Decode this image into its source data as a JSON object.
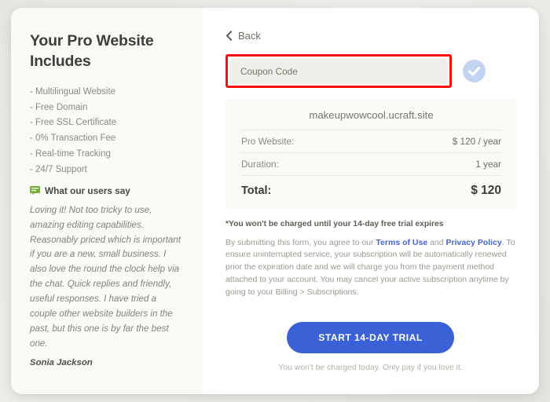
{
  "left_panel": {
    "title": "Your Pro Website Includes",
    "features": [
      "- Multilingual Website",
      "- Free Domain",
      "- Free SSL Certificate",
      "- 0% Transaction Fee",
      "- Real-time Tracking",
      "- 24/7 Support"
    ],
    "users_say_icon": "chat-bubble-icon",
    "users_say_label": "What our users say",
    "testimonial": "Loving it! Not too tricky to use, amazing editing capabilities. Reasonably priced which is important if you are a new, small business. I also love the round the clock help via the chat. Quick replies and friendly, useful responses. I have tried a couple other website builders in the past, but this one is by far the best one.",
    "testimonial_author": "Sonia Jackson"
  },
  "right_panel": {
    "back_label": "Back",
    "back_icon": "chevron-left-icon",
    "coupon": {
      "placeholder": "Coupon Code",
      "value": "",
      "check_icon": "check-circle-icon",
      "highlight_color": "#fb0b0b"
    },
    "summary": {
      "domain": "makeupwowcool.ucraft.site",
      "rows": [
        {
          "label": "Pro Website:",
          "value": "$ 120 / year"
        },
        {
          "label": "Duration:",
          "value": "1 year"
        }
      ],
      "total_label": "Total:",
      "total_value": "$ 120"
    },
    "trial_note": "*You won't be charged until your 14-day free trial expires",
    "legal": {
      "part1": "By submitting this form, you agree to our ",
      "link1": "Terms of Use",
      "part2": " and ",
      "link2": "Privacy Policy",
      "part3": ". To ensure uninterrupted service, your subscription will be automatically renewed prior the expiration date and we will charge you from the payment method attached to your account. You may cancel your active subscription anytime by going to your Billing > Subscriptions."
    },
    "cta_label": "START 14-DAY TRIAL",
    "cta_subtext": "You won't be charged today. Only pay if you love it.",
    "cta_color": "#3a62d6"
  }
}
